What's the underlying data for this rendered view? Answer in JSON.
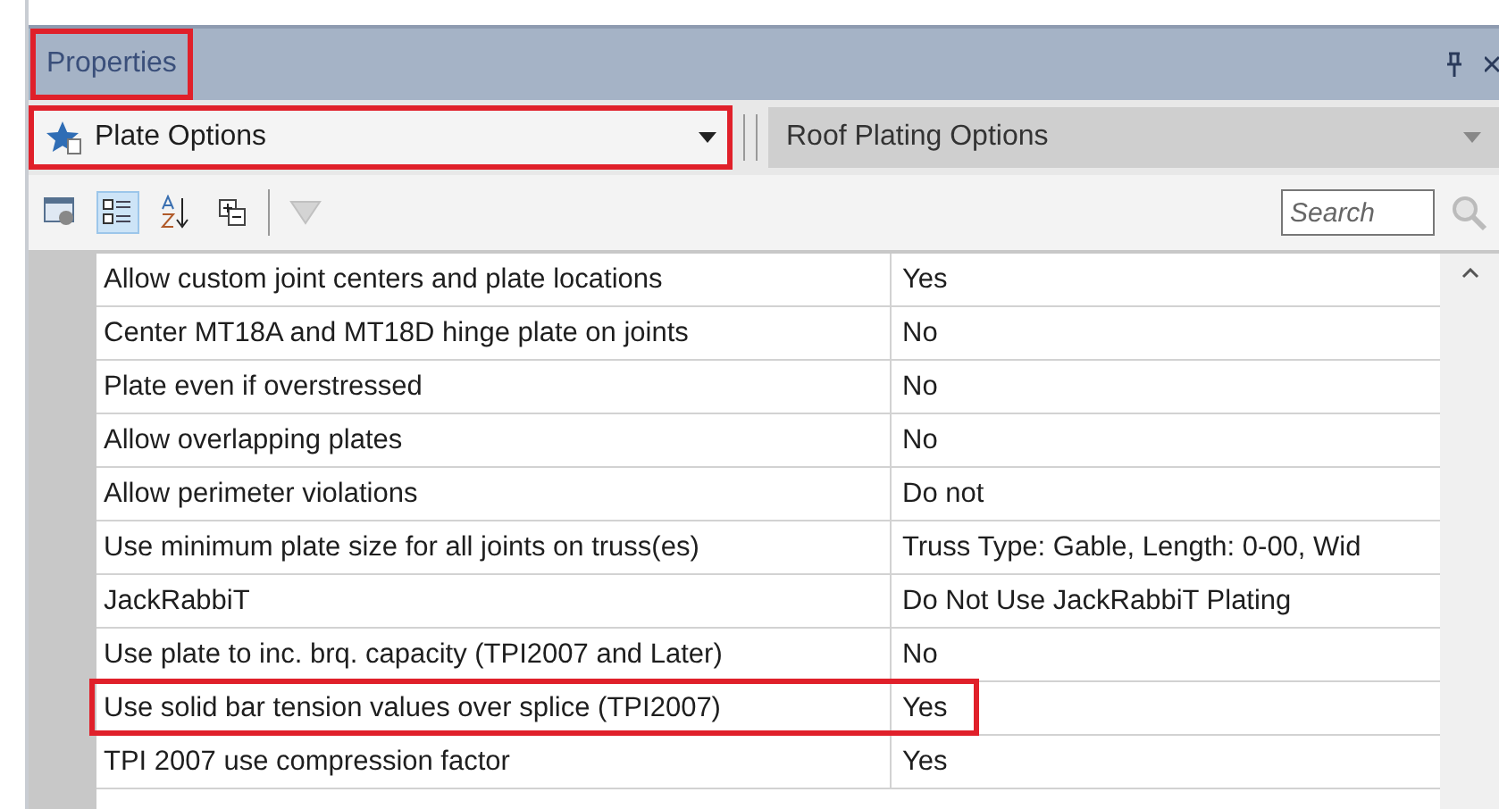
{
  "panel": {
    "title": "Properties",
    "annotated": true
  },
  "object_selector": {
    "value": "Plate Options",
    "annotated": true
  },
  "option_selector": {
    "value": "Roof Plating Options"
  },
  "toolbar": {
    "buttons": [
      {
        "kind": "property-pages",
        "selected": false
      },
      {
        "kind": "categorized",
        "selected": true
      },
      {
        "kind": "alphabetical",
        "selected": false
      },
      {
        "kind": "expand",
        "selected": false
      },
      {
        "kind": "filter",
        "selected": false
      }
    ],
    "search": {
      "placeholder": "Search"
    }
  },
  "rows": [
    {
      "name": "Allow custom joint centers and plate locations",
      "value": "Yes",
      "annotated": false
    },
    {
      "name": "Center MT18A and MT18D hinge plate on joints",
      "value": "No",
      "annotated": false
    },
    {
      "name": "Plate even if overstressed",
      "value": "No",
      "annotated": false
    },
    {
      "name": "Allow overlapping plates",
      "value": "No",
      "annotated": false
    },
    {
      "name": "Allow perimeter violations",
      "value": "Do not",
      "annotated": false
    },
    {
      "name": "Use minimum plate size for all joints on truss(es)",
      "value": "Truss Type: Gable, Length: 0-00, Wid",
      "annotated": false
    },
    {
      "name": "JackRabbiT",
      "value": "Do Not Use JackRabbiT Plating",
      "annotated": false
    },
    {
      "name": "Use plate to inc. brq. capacity (TPI2007 and Later)",
      "value": "No",
      "annotated": false
    },
    {
      "name": "Use solid bar tension values over splice (TPI2007)",
      "value": "Yes",
      "annotated": true
    },
    {
      "name": "TPI 2007 use compression factor",
      "value": "Yes",
      "annotated": false
    }
  ]
}
